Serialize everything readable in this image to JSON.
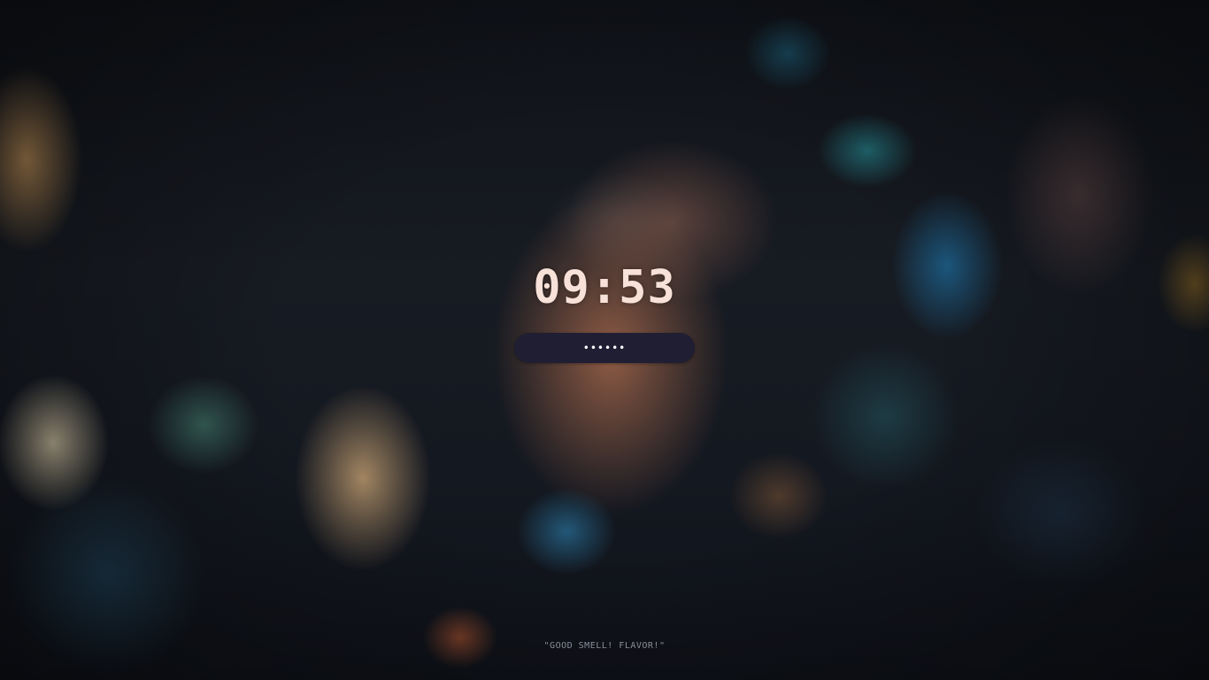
{
  "lockscreen": {
    "clock": "09:53",
    "password": {
      "masked_value": "••••••",
      "field_color": "#1f1e33"
    },
    "quote": "\"GOOD SMELL! FLAVOR!\"",
    "colors": {
      "clock_text": "#f7e1d8",
      "quote_text": "#8a8e9c"
    }
  }
}
